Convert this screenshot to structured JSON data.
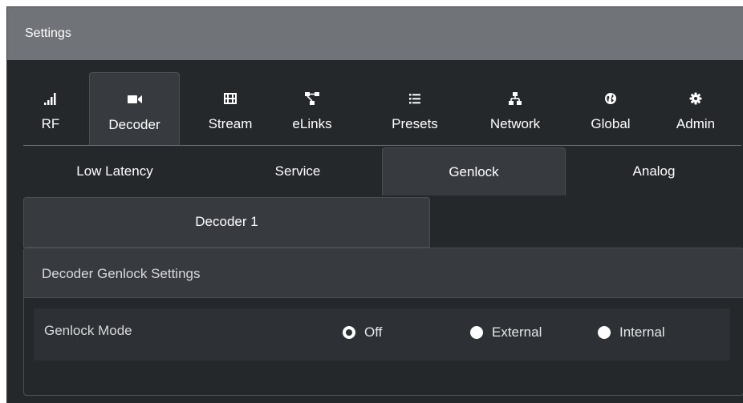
{
  "window": {
    "title": "Settings"
  },
  "nav": {
    "tabs": [
      {
        "label": "RF",
        "icon": "signal-bars-icon"
      },
      {
        "label": "Decoder",
        "icon": "video-camera-icon",
        "active": true
      },
      {
        "label": "Stream",
        "icon": "film-icon"
      },
      {
        "label": "eLinks",
        "icon": "network-links-icon"
      },
      {
        "label": "Presets",
        "icon": "list-icon"
      },
      {
        "label": "Network",
        "icon": "sitemap-icon"
      },
      {
        "label": "Global",
        "icon": "globe-icon"
      },
      {
        "label": "Admin",
        "icon": "gear-icon"
      }
    ]
  },
  "subtabs": [
    {
      "label": "Low Latency"
    },
    {
      "label": "Service"
    },
    {
      "label": "Genlock",
      "active": true
    },
    {
      "label": "Analog"
    }
  ],
  "decoder_tab": {
    "label": "Decoder 1"
  },
  "panel": {
    "title": "Decoder Genlock Settings",
    "genlock_mode": {
      "label": "Genlock Mode",
      "options": [
        "Off",
        "External",
        "Internal"
      ],
      "selected": "Off"
    }
  },
  "colors": {
    "accent_line": "#2c8b8b",
    "titlebar": "#707478",
    "background": "#25282b"
  }
}
